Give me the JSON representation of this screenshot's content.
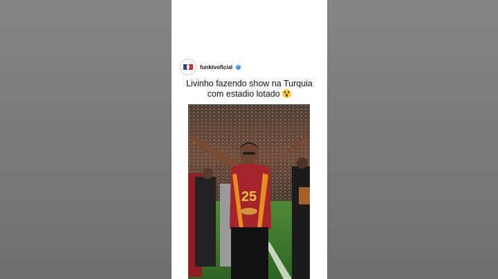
{
  "post": {
    "username": "funktvoficial",
    "verified": true,
    "caption_line1": "Livinho fazendo show na Turquia",
    "caption_line2": "com estadio lotado",
    "caption_emoji": "face-screaming-in-fear-emoji"
  },
  "video": {
    "jersey_number": "25"
  },
  "colors": {
    "verified_blue": "#3897f0",
    "jersey_red": "#a5232b",
    "pitch_green": "#3f7a2e"
  }
}
